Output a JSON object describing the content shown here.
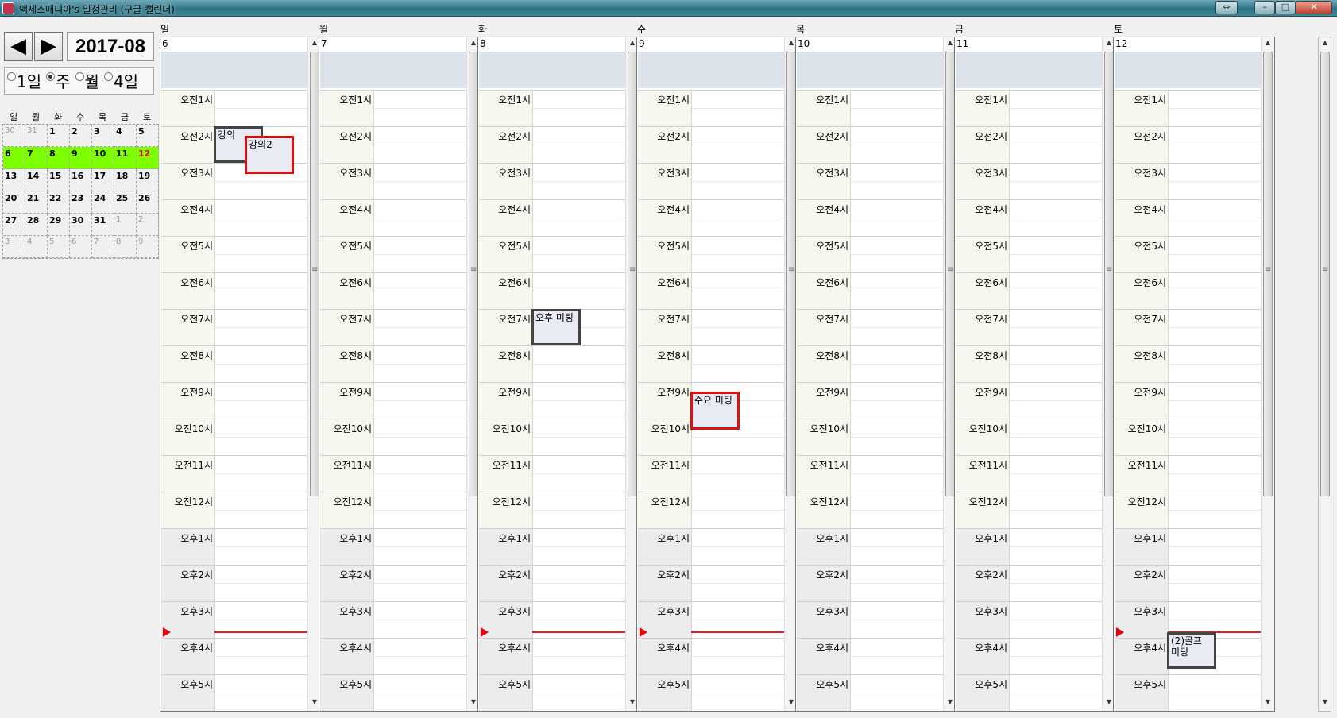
{
  "window": {
    "title": "액세스매니아's 일정관리 (구글 캘린더)"
  },
  "nav": {
    "prev": "◀",
    "next": "▶",
    "month": "2017-08"
  },
  "view_modes": [
    {
      "label": "1일",
      "selected": false
    },
    {
      "label": "주",
      "selected": true
    },
    {
      "label": "월",
      "selected": false
    },
    {
      "label": "4일",
      "selected": false
    }
  ],
  "mini_calendar": {
    "weekdays": [
      "일",
      "월",
      "화",
      "수",
      "목",
      "금",
      "토"
    ],
    "weeks": [
      [
        "30",
        "31",
        "1",
        "2",
        "3",
        "4",
        "5"
      ],
      [
        "6",
        "7",
        "8",
        "9",
        "10",
        "11",
        "12"
      ],
      [
        "13",
        "14",
        "15",
        "16",
        "17",
        "18",
        "19"
      ],
      [
        "20",
        "21",
        "22",
        "23",
        "24",
        "25",
        "26"
      ],
      [
        "27",
        "28",
        "29",
        "30",
        "31",
        "1",
        "2"
      ],
      [
        "3",
        "4",
        "5",
        "6",
        "7",
        "8",
        "9"
      ]
    ],
    "current_week_index": 1,
    "highlight_day": "12"
  },
  "week_days": [
    {
      "name": "일",
      "date": "6"
    },
    {
      "name": "월",
      "date": "7"
    },
    {
      "name": "화",
      "date": "8"
    },
    {
      "name": "수",
      "date": "9"
    },
    {
      "name": "목",
      "date": "10"
    },
    {
      "name": "금",
      "date": "11"
    },
    {
      "name": "토",
      "date": "12"
    }
  ],
  "hours": [
    "오전1시",
    "오전2시",
    "오전3시",
    "오전4시",
    "오전5시",
    "오전6시",
    "오전7시",
    "오전8시",
    "오전9시",
    "오전10시",
    "오전11시",
    "오전12시",
    "오후1시",
    "오후2시",
    "오후3시",
    "오후4시",
    "오후5시"
  ],
  "pm_start_index": 12,
  "current_time_hour": 15.85,
  "current_time_days": [
    0,
    2,
    3,
    6
  ],
  "events": [
    {
      "day": 0,
      "title": "강의",
      "start": 2.0,
      "end": 3.0,
      "lane": 0,
      "color": "#444444"
    },
    {
      "day": 0,
      "title": "강의2",
      "start": 2.25,
      "end": 3.3,
      "lane": 1,
      "color": "#dd1111"
    },
    {
      "day": 2,
      "title": "오후 미팅",
      "start": 7.0,
      "end": 8.0,
      "lane": 0,
      "color": "#444444"
    },
    {
      "day": 3,
      "title": "수요 미팅",
      "start": 9.25,
      "end": 10.3,
      "lane": 0,
      "color": "#dd1111"
    },
    {
      "day": 6,
      "title": "(2)골프 미팅",
      "start": 15.85,
      "end": 16.85,
      "lane": 0,
      "color": "#444444"
    }
  ]
}
